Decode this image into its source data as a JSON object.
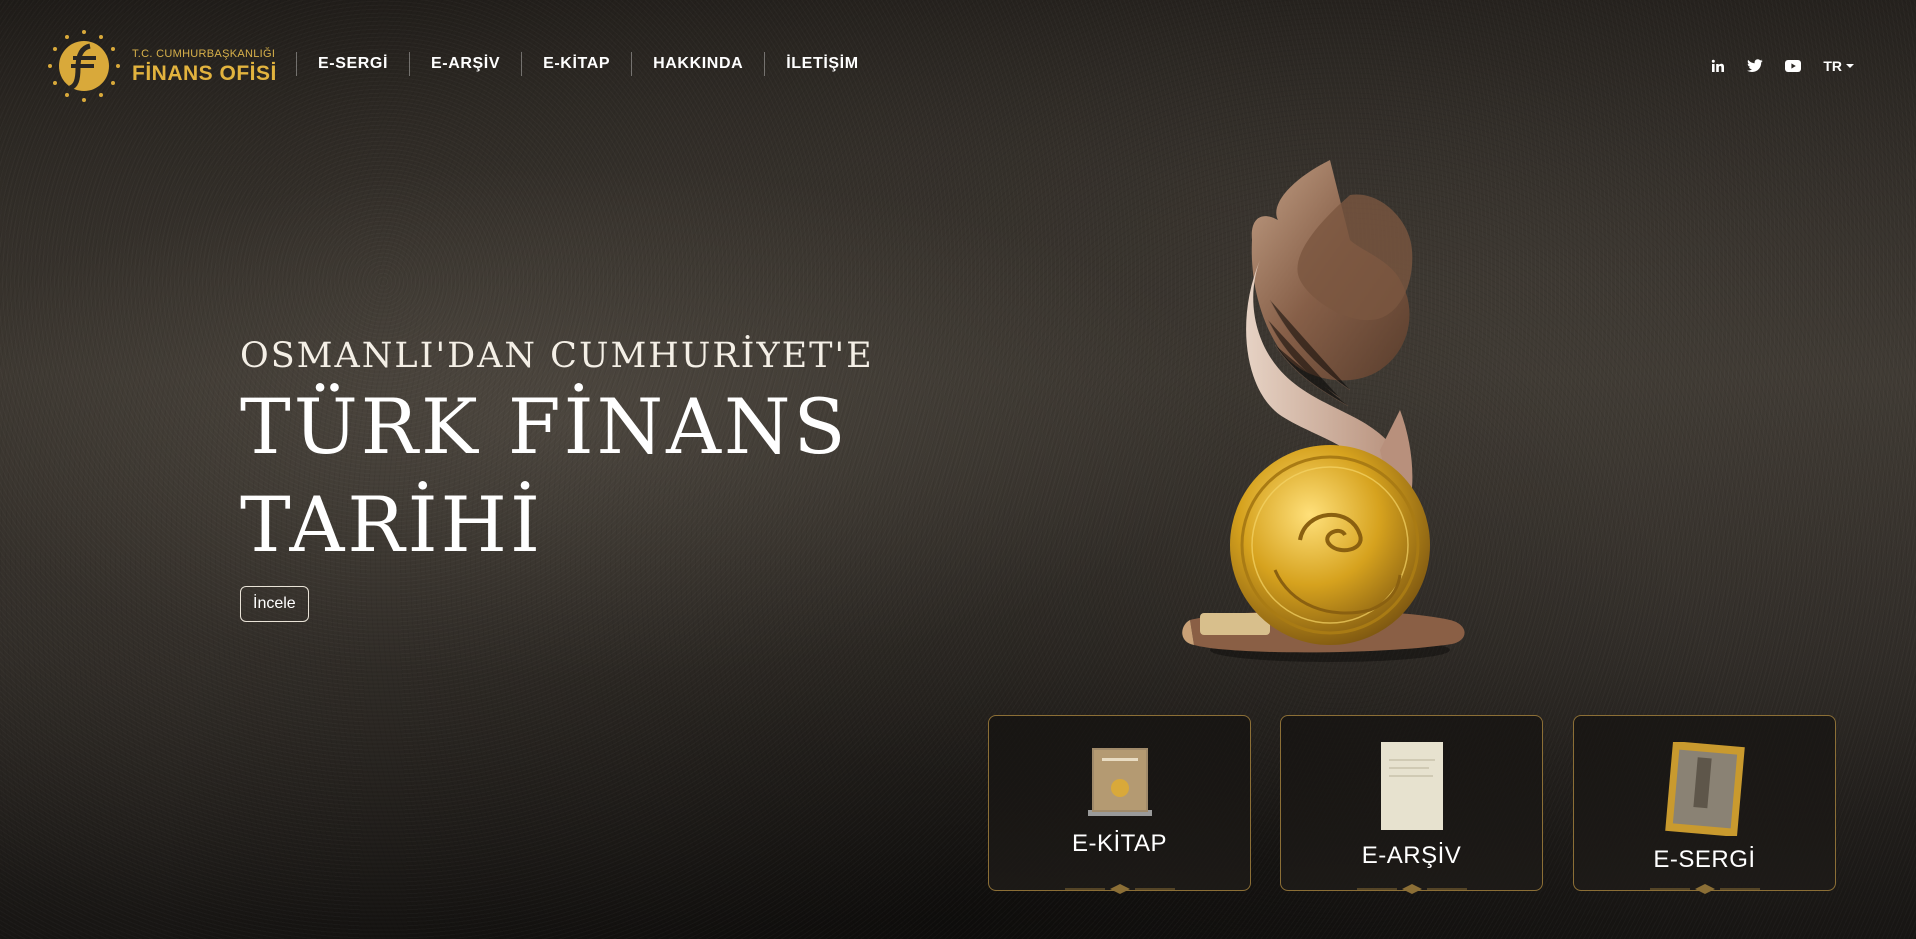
{
  "brand": {
    "line1": "T.C. CUMHURBAŞKANLIĞI",
    "line2": "FİNANS OFİSİ"
  },
  "nav": {
    "items": [
      {
        "label": "E-SERGİ"
      },
      {
        "label": "E-ARŞİV"
      },
      {
        "label": "E-KİTAP"
      },
      {
        "label": "HAKKINDA"
      },
      {
        "label": "İLETİŞİM"
      }
    ]
  },
  "social": {
    "icons": [
      "linkedin-icon",
      "twitter-icon",
      "youtube-icon"
    ],
    "language": "TR"
  },
  "hero": {
    "subtitle": "OSMANLI'DAN CUMHURİYET'E",
    "title_line1": "TÜRK FİNANS",
    "title_line2": "TARİHİ",
    "button": "İncele"
  },
  "cards": [
    {
      "label": "E-KİTAP",
      "icon": "book-icon"
    },
    {
      "label": "E-ARŞİV",
      "icon": "document-icon"
    },
    {
      "label": "E-SERGİ",
      "icon": "framed-painting-icon"
    }
  ],
  "colors": {
    "gold": "#e2b33e",
    "card_border": "#8c6f36",
    "background": "#2a2622"
  }
}
